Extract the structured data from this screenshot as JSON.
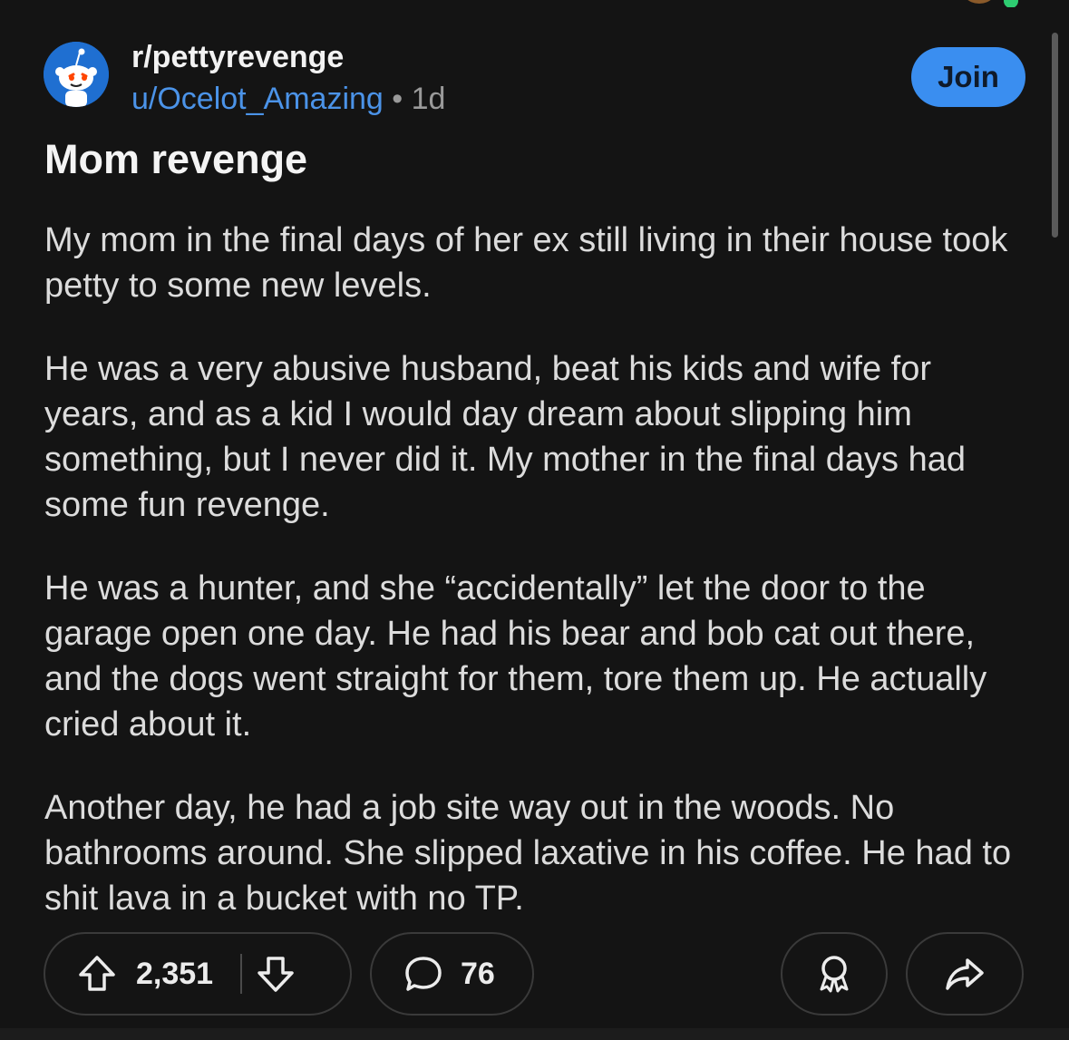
{
  "post": {
    "subreddit": "r/pettyrevenge",
    "author": "u/Ocelot_Amazing",
    "separator": "•",
    "age": "1d",
    "join_label": "Join",
    "title": "Mom revenge",
    "paragraphs": [
      "My mom in the final days of her ex still living in their house took petty to some new levels.",
      "He was a very abusive husband, beat his kids and wife for years, and as a kid I would day dream about slipping him something, but I never did it. My mother in the final days had some fun revenge.",
      "He was a hunter, and she “accidentally” let the door to the garage open one day. He had his bear and bob cat out there, and the dogs went straight for them, tore them up. He actually cried about it.",
      "Another day, he had a job site way out in the woods. No bathrooms around. She slipped laxative in his coffee. He had to shit lava in a bucket with no TP."
    ]
  },
  "actions": {
    "upvotes": "2,351",
    "comments": "76"
  },
  "icons": {
    "subreddit_avatar": "reddit-snoo-icon",
    "upvote": "arrow-up-icon",
    "downvote": "arrow-down-icon",
    "comment": "speech-bubble-icon",
    "award": "award-ribbon-icon",
    "share": "share-arrow-icon"
  },
  "colors": {
    "background": "#141414",
    "username": "#4b93e8",
    "join_button": "#3a8ef0",
    "subreddit_avatar_bg": "#1f6fd1"
  }
}
